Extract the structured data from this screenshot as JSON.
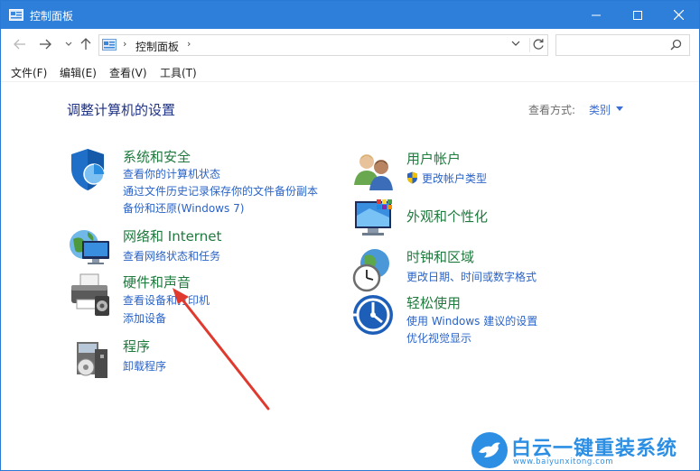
{
  "window": {
    "title": "控制面板"
  },
  "address_bar": {
    "crumb": "控制面板",
    "search_placeholder": ""
  },
  "menu": {
    "items": [
      "文件(F)",
      "编辑(E)",
      "查看(V)",
      "工具(T)"
    ]
  },
  "main": {
    "title": "调整计算机的设置",
    "view_by_label": "查看方式:",
    "view_by_value": "类别"
  },
  "categories_left": [
    {
      "heading": "系统和安全",
      "icon": "shield-icon",
      "links": [
        "查看你的计算机状态",
        "通过文件历史记录保存你的文件备份副本",
        "备份和还原(Windows 7)"
      ]
    },
    {
      "heading": "网络和 Internet",
      "icon": "network-globe-icon",
      "links": [
        "查看网络状态和任务"
      ]
    },
    {
      "heading": "硬件和声音",
      "icon": "printer-icon",
      "links": [
        "查看设备和打印机",
        "添加设备"
      ]
    },
    {
      "heading": "程序",
      "icon": "programs-icon",
      "links": [
        "卸载程序"
      ]
    }
  ],
  "categories_right": [
    {
      "heading": "用户帐户",
      "icon": "users-icon",
      "links": [
        "更改帐户类型"
      ]
    },
    {
      "heading": "外观和个性化",
      "icon": "monitor-colors-icon",
      "links": []
    },
    {
      "heading": "时钟和区域",
      "icon": "clock-globe-icon",
      "links": [
        "更改日期、时间或数字格式"
      ]
    },
    {
      "heading": "轻松使用",
      "icon": "ease-of-access-icon",
      "links": [
        "使用 Windows 建议的设置",
        "优化视觉显示"
      ]
    }
  ],
  "watermark": {
    "brand": "白云一键重装系统",
    "url": "www.baiyunxitong.com"
  },
  "colors": {
    "titlebar": "#2d7fd9",
    "heading_green": "#1e7a3d",
    "link_blue": "#2a63c8",
    "page_title": "#1e3287",
    "arrow_red": "#e03a2f"
  }
}
